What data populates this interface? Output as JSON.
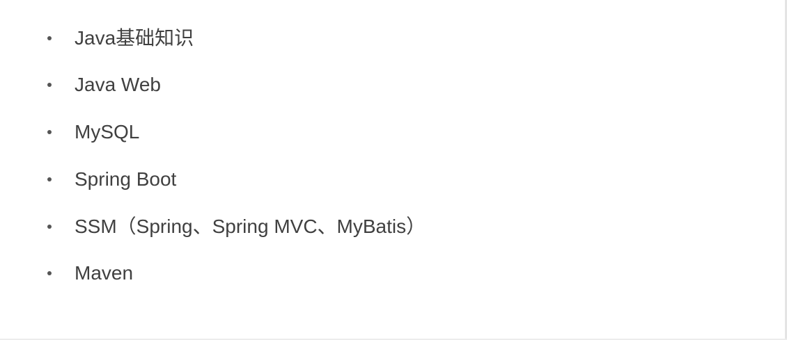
{
  "list": {
    "items": [
      {
        "label": "Java基础知识"
      },
      {
        "label": "Java Web"
      },
      {
        "label": "MySQL"
      },
      {
        "label": "Spring Boot"
      },
      {
        "label": "SSM（Spring、Spring MVC、MyBatis）"
      },
      {
        "label": "Maven"
      }
    ]
  }
}
